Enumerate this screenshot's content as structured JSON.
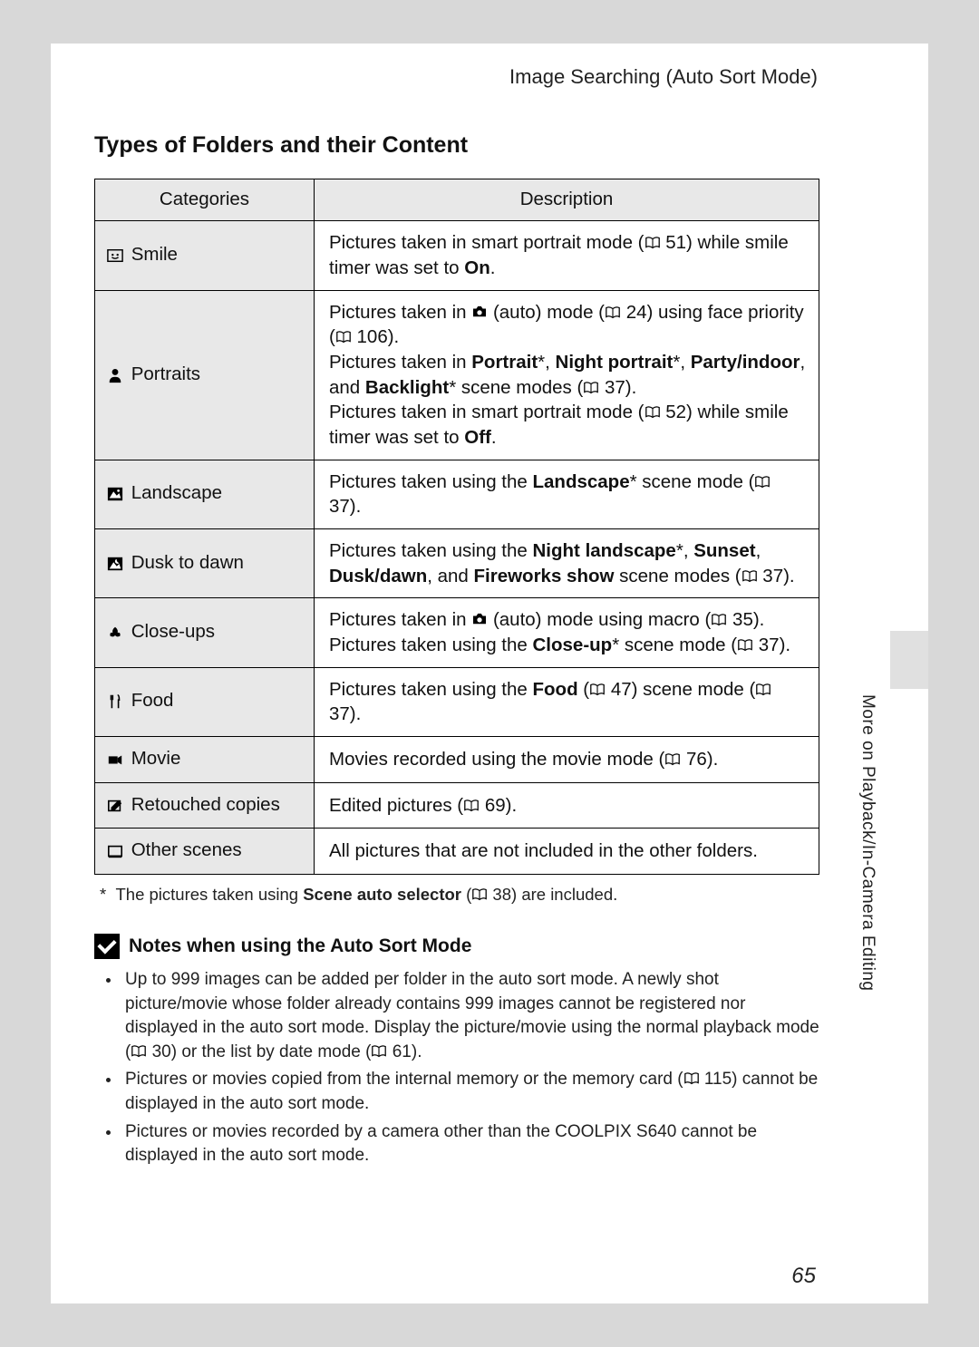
{
  "header": "Image Searching (Auto Sort Mode)",
  "section_title": "Types of Folders and their Content",
  "table": {
    "col_categories": "Categories",
    "col_description": "Description"
  },
  "rows": {
    "smile": {
      "label": "Smile",
      "d1": "Pictures taken in smart portrait mode (",
      "d2": " 51) while smile timer was set to ",
      "d3": "On",
      "d4": "."
    },
    "portraits": {
      "label": "Portraits",
      "p1a": "Pictures taken in ",
      "p1b": " (auto) mode (",
      "p1c": " 24) using face priority (",
      "p1d": " 106).",
      "p2a": "Pictures taken in ",
      "p2b": "Portrait",
      "p2c": "*, ",
      "p2d": "Night portrait",
      "p2e": "*, ",
      "p2f": "Party/indoor",
      "p2g": ", and ",
      "p2h": "Backlight",
      "p2i": "* scene modes (",
      "p2j": " 37).",
      "p3a": "Pictures taken in smart portrait mode (",
      "p3b": " 52) while smile timer was set to ",
      "p3c": "Off",
      "p3d": "."
    },
    "landscape": {
      "label": "Landscape",
      "d1": "Pictures taken using the ",
      "d2": "Landscape",
      "d3": "* scene mode (",
      "d4": " 37)."
    },
    "dusk": {
      "label": "Dusk to dawn",
      "d1": "Pictures taken using the ",
      "d2": "Night landscape",
      "d3": "*, ",
      "d4": "Sunset",
      "d5": ", ",
      "d6": "Dusk/dawn",
      "d7": ", and ",
      "d8": "Fireworks show",
      "d9": " scene modes (",
      "d10": " 37)."
    },
    "closeups": {
      "label": "Close-ups",
      "l1a": "Pictures taken in ",
      "l1b": " (auto) mode using macro (",
      "l1c": " 35).",
      "l2a": "Pictures taken using the ",
      "l2b": "Close-up",
      "l2c": "* scene mode (",
      "l2d": " 37)."
    },
    "food": {
      "label": "Food",
      "d1": "Pictures taken using the ",
      "d2": "Food",
      "d3": " (",
      "d4": " 47) scene mode (",
      "d5": " 37)."
    },
    "movie": {
      "label": "Movie",
      "d1": "Movies recorded using the movie mode (",
      "d2": " 76)."
    },
    "retouched": {
      "label": "Retouched copies",
      "d1": "Edited pictures (",
      "d2": " 69)."
    },
    "other": {
      "label": "Other scenes",
      "d1": "All pictures that are not included in the other folders."
    }
  },
  "footnote": {
    "star": "*",
    "t1": "The pictures taken using ",
    "t2": "Scene auto selector",
    "t3": " (",
    "t4": " 38) are included."
  },
  "notes": {
    "title": "Notes when using the Auto Sort Mode",
    "n1a": "Up to 999 images can be added per folder in the auto sort mode. A newly shot picture/movie whose folder already contains 999 images cannot be registered nor displayed in the auto sort mode. Display the picture/movie using the normal playback mode (",
    "n1b": " 30) or the list by date mode (",
    "n1c": " 61).",
    "n2a": "Pictures or movies copied from the internal memory or the memory card (",
    "n2b": " 115) cannot be displayed in the auto sort mode.",
    "n3": "Pictures or movies recorded by a camera other than the COOLPIX S640 cannot be displayed in the auto sort mode."
  },
  "side_label": "More on Playback/In-Camera Editing",
  "page_number": "65"
}
